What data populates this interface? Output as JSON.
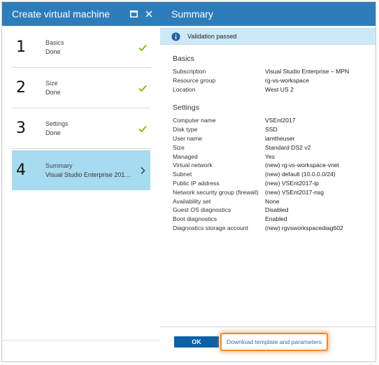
{
  "left_blade": {
    "title": "Create virtual machine",
    "steps": [
      {
        "number": "1",
        "label": "Basics",
        "status": "Done"
      },
      {
        "number": "2",
        "label": "Size",
        "status": "Done"
      },
      {
        "number": "3",
        "label": "Settings",
        "status": "Done"
      },
      {
        "number": "4",
        "label": "Summary",
        "status": "Visual Studio Enterprise 2017 (..."
      }
    ]
  },
  "right_blade": {
    "title": "Summary",
    "validation_text": "Validation passed",
    "basics": {
      "heading": "Basics",
      "rows": [
        {
          "key": "Subscription",
          "value": "Visual Studio Enterprise – MPN"
        },
        {
          "key": "Resource group",
          "value": "rg-vs-workspace"
        },
        {
          "key": "Location",
          "value": "West US 2"
        }
      ]
    },
    "settings": {
      "heading": "Settings",
      "rows": [
        {
          "key": "Computer name",
          "value": "VSEnt2017"
        },
        {
          "key": "Disk type",
          "value": "SSD"
        },
        {
          "key": "User name",
          "value": "iamtheuser"
        },
        {
          "key": "Size",
          "value": "Standard DS2 v2"
        },
        {
          "key": "Managed",
          "value": "Yes"
        },
        {
          "key": "Virtual network",
          "value": "(new) rg-vs-workspace-vnet"
        },
        {
          "key": "Subnet",
          "value": "(new) default (10.0.0.0/24)"
        },
        {
          "key": "Public IP address",
          "value": "(new) VSEnt2017-ip"
        },
        {
          "key": "Network security group (firewall)",
          "value": "(new) VSEnt2017-nsg"
        },
        {
          "key": "Availability set",
          "value": "None"
        },
        {
          "key": "Guest OS diagnostics",
          "value": "Disabled"
        },
        {
          "key": "Boot diagnostics",
          "value": "Enabled"
        },
        {
          "key": "Diagnostics storage account",
          "value": "(new) rgvsworkspacediag602"
        }
      ]
    },
    "ok_label": "OK",
    "download_label": "Download template and parameters"
  },
  "colors": {
    "header_blue": "#2d7dbb",
    "active_step": "#a7dbef",
    "banner": "#cde9f7",
    "check_green": "#7fba00",
    "ok_button": "#0b61a4",
    "highlight_orange": "#f08a2c"
  }
}
